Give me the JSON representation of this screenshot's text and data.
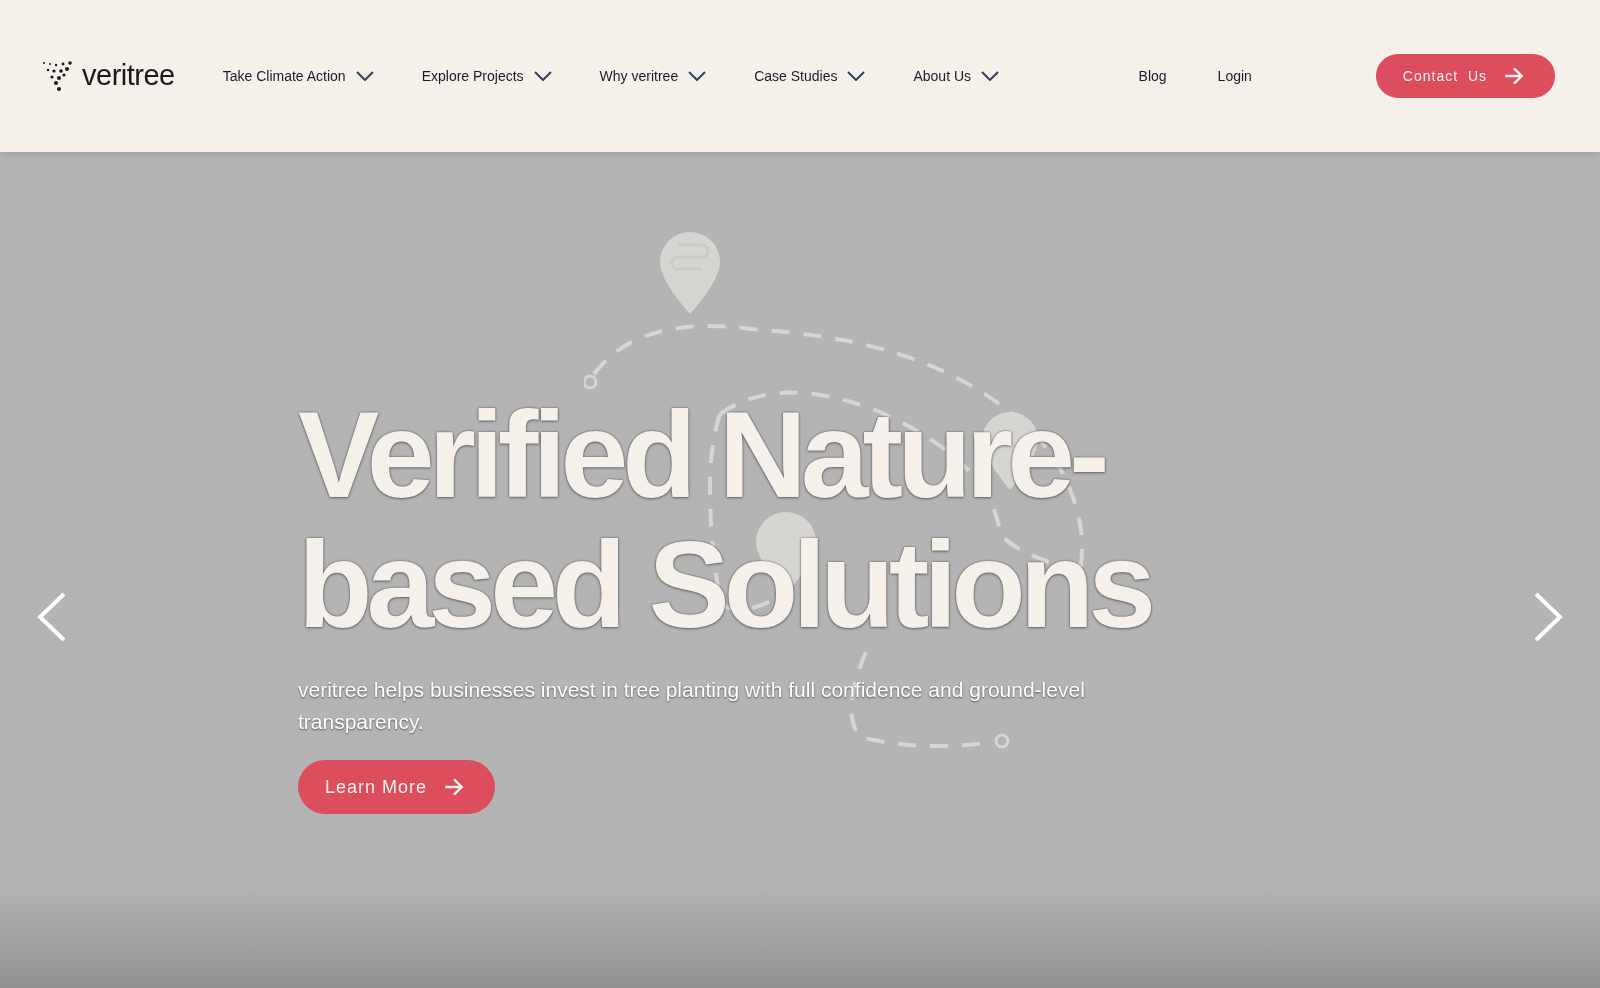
{
  "header": {
    "logo": "veritree",
    "menu": [
      {
        "label": "Take Climate Action",
        "dropdown": true
      },
      {
        "label": "Explore Projects",
        "dropdown": true
      },
      {
        "label": "Why veritree",
        "dropdown": true
      },
      {
        "label": "Case Studies",
        "dropdown": true
      },
      {
        "label": "About Us",
        "dropdown": true
      }
    ],
    "links": [
      "Blog",
      "Login"
    ],
    "contact_button": "Contact  Us"
  },
  "hero": {
    "title_lines": [
      "Verified Nature-",
      "based Solutions"
    ],
    "subtitle": "veritree helps businesses invest in tree planting with full confidence and ground-level transparency.",
    "button": "Learn More"
  }
}
